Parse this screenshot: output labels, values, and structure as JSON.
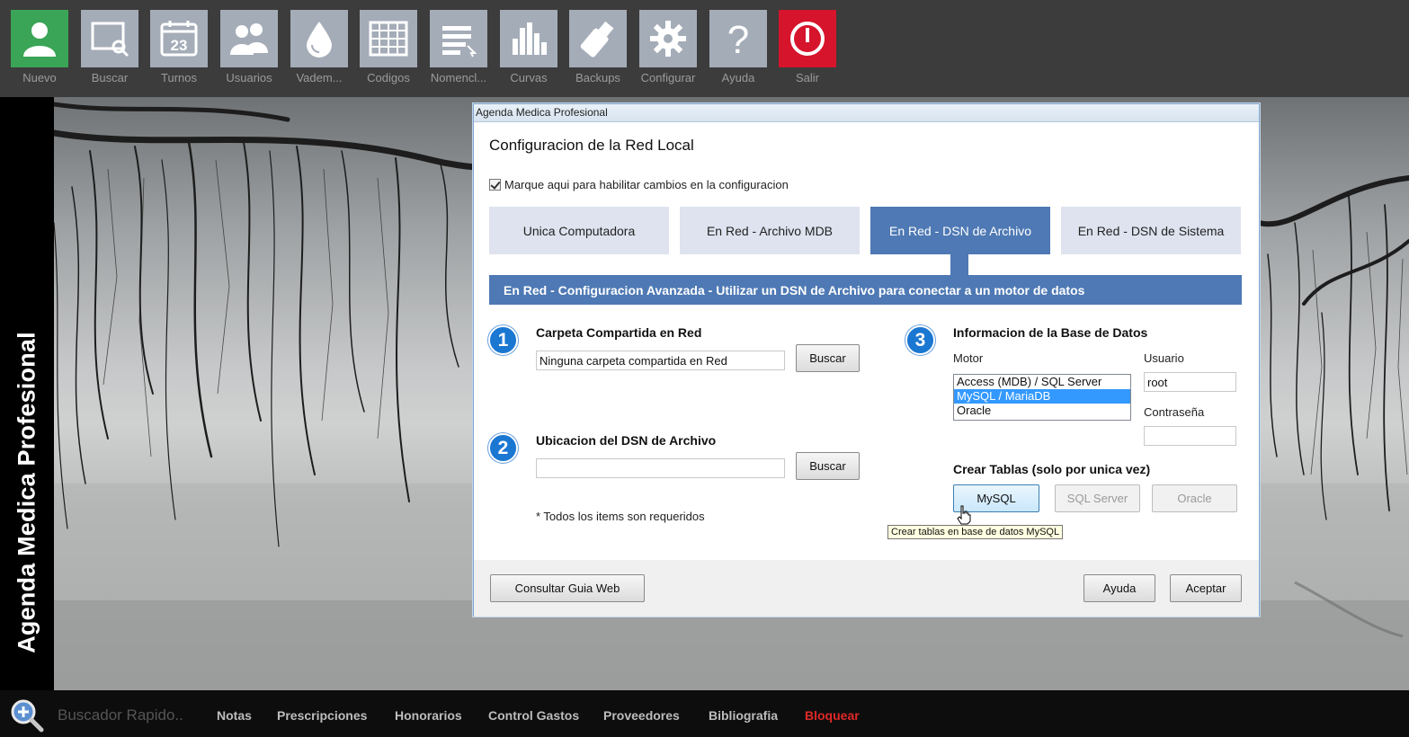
{
  "toolbar": {
    "items": [
      {
        "label": "Nuevo",
        "icon": "user-plus-icon"
      },
      {
        "label": "Buscar",
        "icon": "search-window-icon"
      },
      {
        "label": "Turnos",
        "icon": "calendar-icon"
      },
      {
        "label": "Usuarios",
        "icon": "users-icon"
      },
      {
        "label": "Vadem...",
        "icon": "drop-icon"
      },
      {
        "label": "Codigos",
        "icon": "grid-icon"
      },
      {
        "label": "Nomencl...",
        "icon": "list-icon"
      },
      {
        "label": "Curvas",
        "icon": "bar-chart-icon"
      },
      {
        "label": "Backups",
        "icon": "usb-drive-icon"
      },
      {
        "label": "Configurar",
        "icon": "gear-icon"
      },
      {
        "label": "Ayuda",
        "icon": "question-icon"
      },
      {
        "label": "Salir",
        "icon": "power-icon"
      }
    ],
    "calendar_day": "23"
  },
  "sidebar": {
    "title": "Agenda Medica Profesional"
  },
  "dialog": {
    "window_title": "Agenda Medica Profesional",
    "heading": "Configuracion de la Red Local",
    "enable_checkbox_label": "Marque aqui para habilitar cambios en la configuracion",
    "enable_checked": true,
    "modes": [
      "Unica Computadora",
      "En Red - Archivo MDB",
      "En Red - DSN de Archivo",
      "En Red - DSN de Sistema"
    ],
    "active_mode": "En Red - DSN de Archivo",
    "banner": "En Red - Configuracion Avanzada - Utilizar un DSN de Archivo para conectar a un motor de datos",
    "step1": {
      "number": "1",
      "title": "Carpeta Compartida en Red",
      "value": "Ninguna carpeta compartida en Red",
      "button": "Buscar"
    },
    "step2": {
      "number": "2",
      "title": "Ubicacion del DSN de Archivo",
      "value": "",
      "button": "Buscar"
    },
    "required_note": "* Todos los items son requeridos",
    "step3": {
      "number": "3",
      "title": "Informacion de la Base de Datos",
      "engine_label": "Motor",
      "engines": [
        "Access (MDB) / SQL Server",
        "MySQL / MariaDB",
        "Oracle"
      ],
      "selected_engine": "MySQL / MariaDB",
      "user_label": "Usuario",
      "user_value": "root",
      "password_label": "Contraseña",
      "password_value": ""
    },
    "create_tables": {
      "title": "Crear Tablas (solo por unica vez)",
      "buttons": [
        "MySQL",
        "SQL Server",
        "Oracle"
      ],
      "tooltip": "Crear tablas en base de datos MySQL"
    },
    "footer": {
      "guide_button": "Consultar Guia Web",
      "help_button": "Ayuda",
      "accept_button": "Aceptar"
    }
  },
  "bottombar": {
    "search_placeholder": "Buscador Rapido..",
    "links": [
      "Notas",
      "Prescripciones",
      "Honorarios",
      "Control Gastos",
      "Proveedores",
      "Bibliografia",
      "Bloquear"
    ]
  },
  "colors": {
    "accent": "#4e79b4",
    "nuevo": "#3aa556",
    "salir": "#d6142c",
    "bloquear": "#e02828",
    "step": "#1a77d2"
  }
}
